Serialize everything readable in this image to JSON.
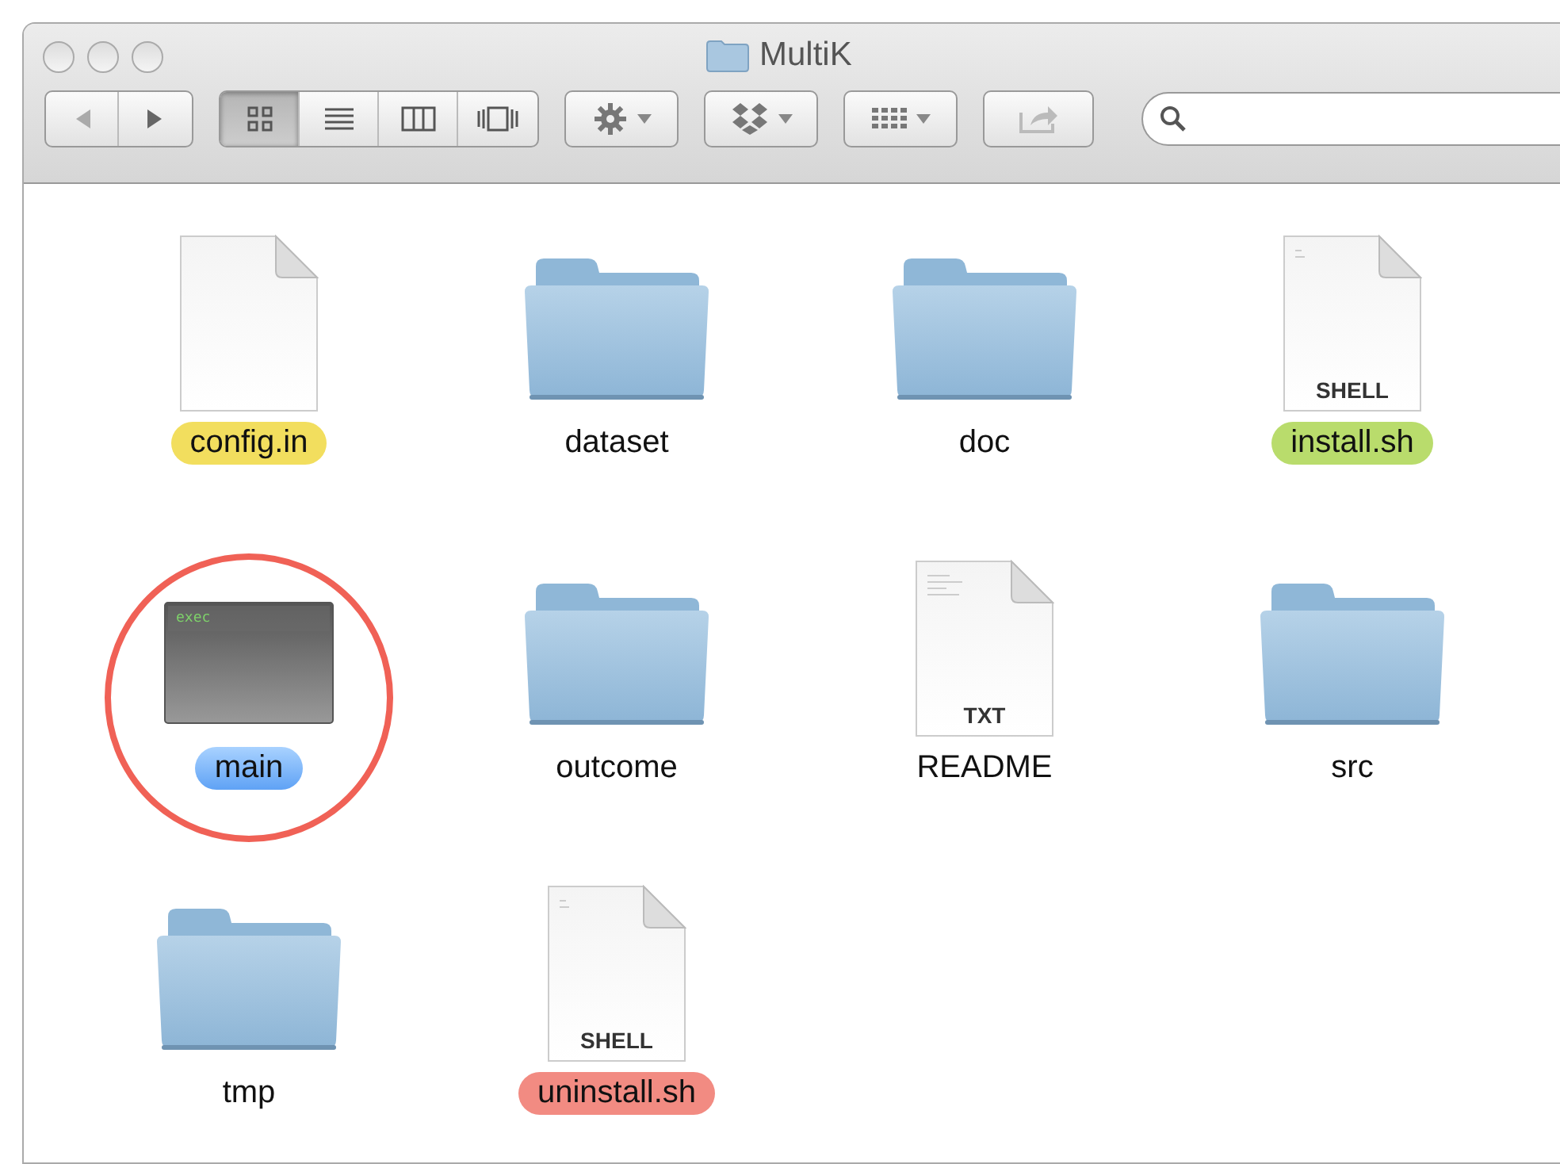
{
  "window": {
    "title": "MultiK"
  },
  "view_modes": [
    {
      "kind": "icons",
      "selected": true
    },
    {
      "kind": "list",
      "selected": false
    },
    {
      "kind": "columns",
      "selected": false
    },
    {
      "kind": "coverflow",
      "selected": false
    }
  ],
  "items": [
    {
      "name": "config.in",
      "kind": "document",
      "color": "#f2de5e",
      "selected": false
    },
    {
      "name": "dataset",
      "kind": "folder",
      "selected": false
    },
    {
      "name": "doc",
      "kind": "folder",
      "selected": false
    },
    {
      "name": "install.sh",
      "kind": "script",
      "badge": "SHELL",
      "color": "#b9dc6c",
      "selected": false
    },
    {
      "name": "main",
      "kind": "executable",
      "badge": "exec",
      "selected": true,
      "circled": true
    },
    {
      "name": "outcome",
      "kind": "folder",
      "selected": false
    },
    {
      "name": "README",
      "kind": "text",
      "badge": "TXT",
      "selected": false
    },
    {
      "name": "src",
      "kind": "folder",
      "selected": false
    },
    {
      "name": "tmp",
      "kind": "folder",
      "selected": false
    },
    {
      "name": "uninstall.sh",
      "kind": "script",
      "badge": "SHELL",
      "color": "#f28b82",
      "selected": false
    }
  ]
}
